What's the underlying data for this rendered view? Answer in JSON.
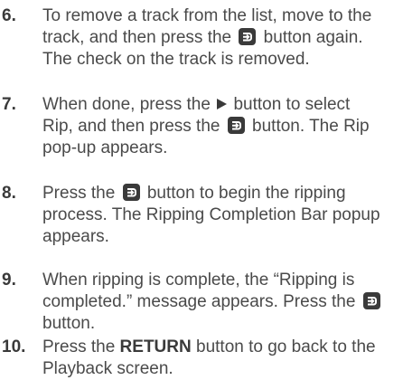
{
  "steps": [
    {
      "number": "6.",
      "lines": [
        [
          "To remove a track from the list, move to the"
        ],
        [
          "track, and then press the ",
          "{enter}",
          " button again."
        ],
        [
          "The check on the track is removed."
        ]
      ]
    },
    {
      "number": "7.",
      "lines": [
        [
          "When done, press the ",
          "{play}",
          " button to select"
        ],
        [
          "Rip, and then press the ",
          "{enter}",
          " button. The Rip"
        ],
        [
          "pop-up appears."
        ]
      ]
    },
    {
      "number": "8.",
      "lines": [
        [
          "Press the ",
          "{enter}",
          " button to begin the ripping"
        ],
        [
          "process. The Ripping Completion Bar popup"
        ],
        [
          "appears."
        ]
      ]
    },
    {
      "number": "9.",
      "lines": [
        [
          "When ripping is complete, the “Ripping is"
        ],
        [
          "completed.” message appears. Press the ",
          "{enter}"
        ],
        [
          "button."
        ]
      ]
    },
    {
      "number": "10.",
      "lines": [
        [
          "Press the ",
          "{b:RETURN}",
          " button to go back to the"
        ],
        [
          "Playback screen."
        ]
      ]
    }
  ],
  "icons": {
    "enter": "enter-button-icon",
    "play": "play-button-icon"
  }
}
